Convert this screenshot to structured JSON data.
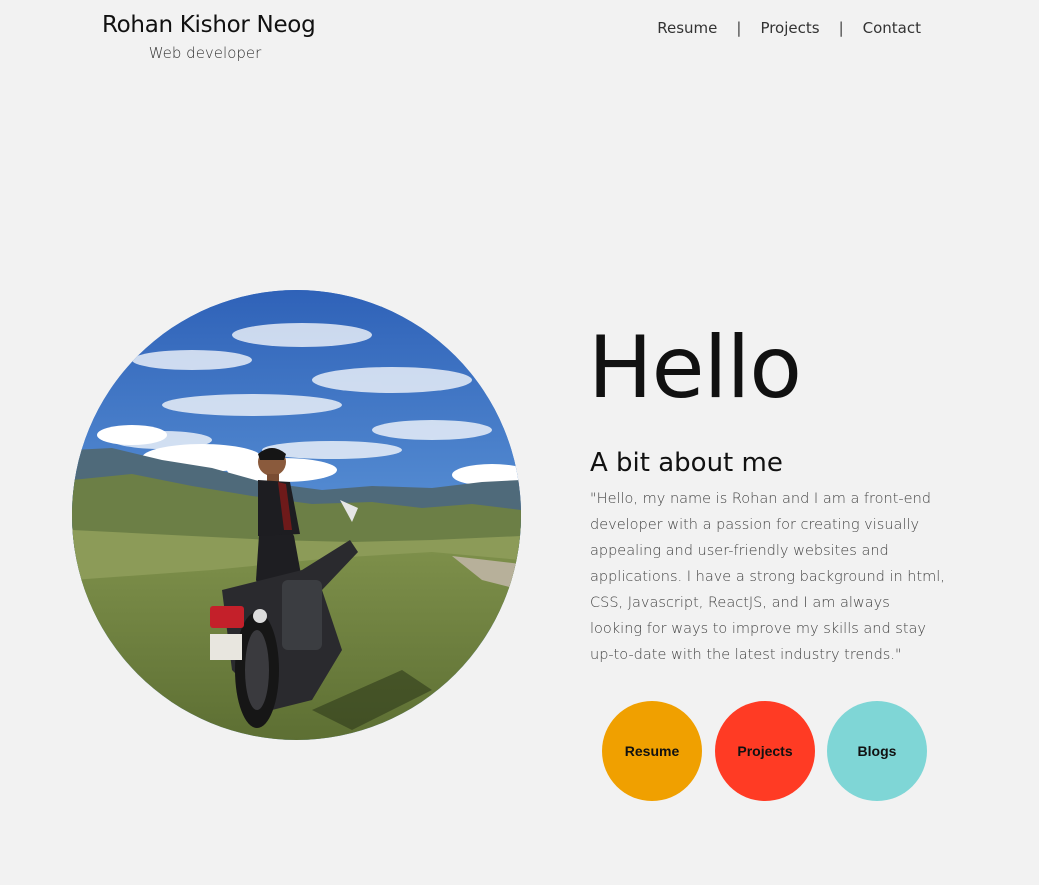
{
  "header": {
    "name": "Rohan Kishor Neog",
    "tagline": "Web developer"
  },
  "nav": {
    "items": [
      "Resume",
      "Projects",
      "Contact"
    ],
    "separator": "|"
  },
  "hero": {
    "title": "Hello",
    "about_heading": "A bit about me",
    "about_text": "\"Hello, my name is Rohan and I am a front-end developer with a passion for creating visually appealing and user-friendly websites and applications. I have a strong background in html, CSS, Javascript, ReactJS, and I am always looking for ways to improve my skills and stay up-to-date with the latest industry trends.\""
  },
  "buttons": [
    {
      "label": "Resume",
      "color": "#f0a000"
    },
    {
      "label": "Projects",
      "color": "#ff3b24"
    },
    {
      "label": "Blogs",
      "color": "#7fd6d6"
    }
  ],
  "colors": {
    "background": "#f2f2f2",
    "text": "#111111"
  }
}
